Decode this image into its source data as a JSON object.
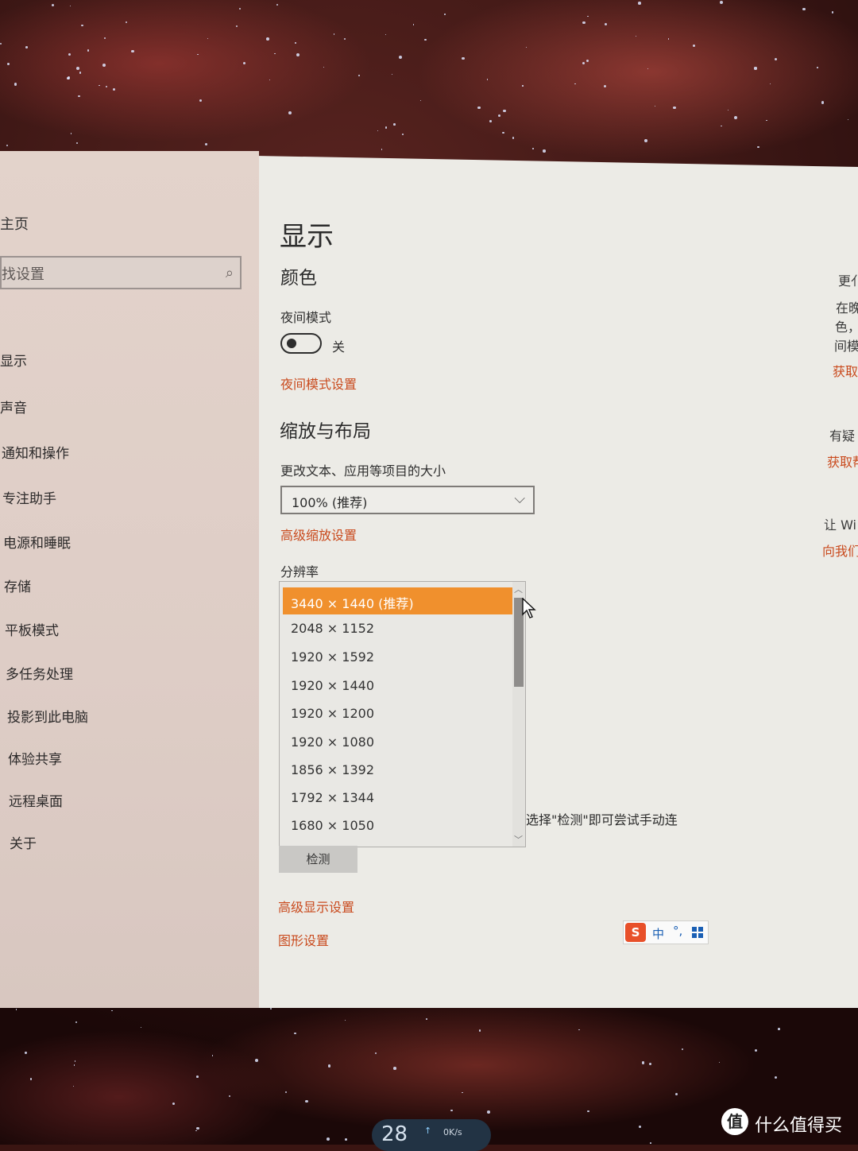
{
  "sidebar": {
    "home_label": "主页",
    "search_placeholder": "找设置",
    "items": [
      {
        "label": "显示"
      },
      {
        "label": "声音"
      },
      {
        "label": "通知和操作"
      },
      {
        "label": "专注助手"
      },
      {
        "label": "电源和睡眠"
      },
      {
        "label": "存储"
      },
      {
        "label": "平板模式"
      },
      {
        "label": "多任务处理"
      },
      {
        "label": "投影到此电脑"
      },
      {
        "label": "体验共享"
      },
      {
        "label": "远程桌面"
      },
      {
        "label": "关于"
      }
    ]
  },
  "main": {
    "title": "显示",
    "color_heading": "颜色",
    "night_mode_label": "夜间模式",
    "night_mode_state": "关",
    "night_mode_settings_link": "夜间模式设置",
    "scale_heading": "缩放与布局",
    "scale_label": "更改文本、应用等项目的大小",
    "scale_value": "100% (推荐)",
    "advanced_scaling_link": "高级缩放设置",
    "resolution_label": "分辨率",
    "resolution_options": [
      "3440 × 1440 (推荐)",
      "2048 × 1152",
      "1920 × 1592",
      "1920 × 1440",
      "1920 × 1200",
      "1920 × 1080",
      "1856 × 1392",
      "1792 × 1344",
      "1680 × 1050"
    ],
    "selected_resolution_index": 0,
    "detect_hint_cut": "选择\"检测\"即可尝试手动连",
    "detect_button": "检测",
    "advanced_display_link": "高级显示设置",
    "graphics_settings_link": "图形设置"
  },
  "right_panel": {
    "text_1": "更亻",
    "text_2": "在晚",
    "text_3": "色，",
    "text_4": "间模",
    "link_1": "获取",
    "text_5": "有疑",
    "link_2": "获取帮",
    "text_6": "让 Wi",
    "link_3": "向我们"
  },
  "ime": {
    "zh_label": "中",
    "punct": "°,"
  },
  "gadget": {
    "temperature": "28",
    "speed": "0K/s"
  },
  "watermark": {
    "text": "什么值得买",
    "logo": "值"
  }
}
